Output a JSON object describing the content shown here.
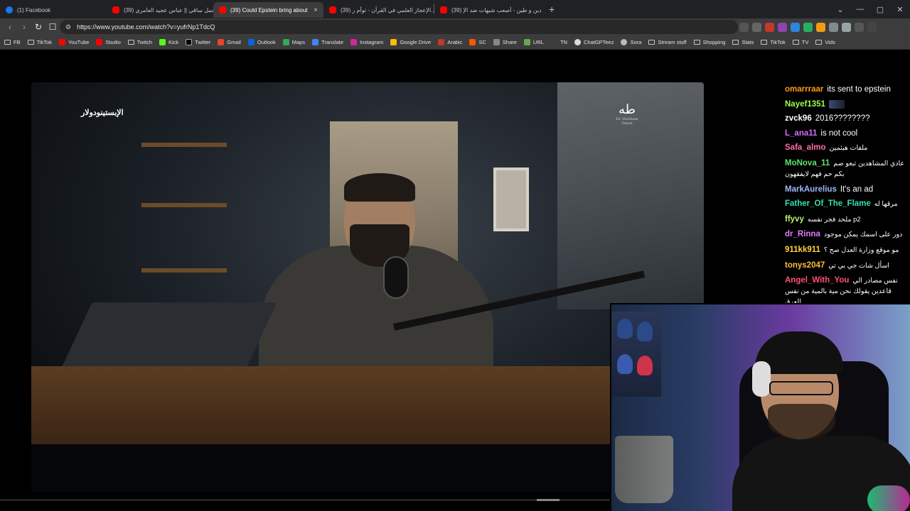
{
  "browser": {
    "tabs": [
      {
        "title": "(1) Facebook",
        "icon": "facebook-icon",
        "active": false
      },
      {
        "title": "(39) احمل ساقي || عباس عجيد العامري",
        "icon": "youtube-icon",
        "active": false
      },
      {
        "title": "(39) Could Epstein bring about t",
        "icon": "youtube-icon",
        "active": true
      },
      {
        "title": "(39) الإعجاز العلمي في القرآن - توأم ر...",
        "icon": "youtube-icon",
        "active": false
      },
      {
        "title": "(39) دين و طين - أصعب شبهات ضد الإ",
        "icon": "youtube-icon",
        "active": false
      }
    ],
    "close_glyph": "×",
    "new_tab_glyph": "+",
    "window_controls": {
      "dropdown": "⌄",
      "minimize": "—",
      "maximize": "▢",
      "close": "✕"
    },
    "url": "https://www.youtube.com/watch?v=yufrNp1TdcQ",
    "bookmarks": [
      {
        "label": "FB",
        "icon": "folder-icon"
      },
      {
        "label": "TikTok",
        "icon": "folder-icon"
      },
      {
        "label": "YouTube",
        "icon": "youtube-icon"
      },
      {
        "label": "Studio",
        "icon": "youtube-studio-icon"
      },
      {
        "label": "Twitch",
        "icon": "folder-icon"
      },
      {
        "label": "Kick",
        "icon": "kick-icon"
      },
      {
        "label": "Twitter",
        "icon": "x-icon"
      },
      {
        "label": "Gmail",
        "icon": "gmail-icon"
      },
      {
        "label": "Outlook",
        "icon": "outlook-icon"
      },
      {
        "label": "Maps",
        "icon": "maps-icon"
      },
      {
        "label": "Translate",
        "icon": "translate-icon"
      },
      {
        "label": "Instagram",
        "icon": "instagram-icon"
      },
      {
        "label": "Google Drive",
        "icon": "drive-icon"
      },
      {
        "label": "Arabic",
        "icon": "arabic-icon"
      },
      {
        "label": "SC",
        "icon": "soundcloud-icon"
      },
      {
        "label": "Share",
        "icon": "share-icon"
      },
      {
        "label": "URL",
        "icon": "url-icon"
      },
      {
        "label": "TN",
        "icon": "tn-icon"
      },
      {
        "label": "ChatGPTeez",
        "icon": "chatgpt-icon"
      },
      {
        "label": "Sora",
        "icon": "sora-icon"
      },
      {
        "label": "Stream stuff",
        "icon": "folder-icon"
      },
      {
        "label": "Shopping",
        "icon": "folder-icon"
      },
      {
        "label": "Stats",
        "icon": "folder-icon"
      },
      {
        "label": "TikTok",
        "icon": "folder-icon"
      },
      {
        "label": "TV",
        "icon": "folder-icon"
      },
      {
        "label": "Vids",
        "icon": "folder-icon"
      }
    ]
  },
  "video": {
    "caption": "الإبستينودولار",
    "logo_text": "طه",
    "logo_sub": "Dr. Haitham Talaat"
  },
  "chat": [
    {
      "user": "omarrraar",
      "color": "#ff9a1f",
      "text": "its sent to epstein"
    },
    {
      "user": "Nayef1351",
      "color": "#9cff4a",
      "text": "",
      "emote": true
    },
    {
      "user": "zvck96",
      "color": "#ffffff",
      "text": "2016????????"
    },
    {
      "user": "L_ana11",
      "color": "#d36bff",
      "text": "is not cool"
    },
    {
      "user": "Safa_almo",
      "color": "#ff6fa8",
      "text": "ملفات هيثمين",
      "ar": true
    },
    {
      "user": "MoNova_11",
      "color": "#5ce66a",
      "text": "عادي المشاهدين تبعو صم بكم حم فهم لايفقهون",
      "ar": true
    },
    {
      "user": "MarkAurelius",
      "color": "#9db8ff",
      "text": "It's an ad"
    },
    {
      "user": "Father_Of_The_Flame",
      "color": "#34e0b0",
      "text": "مرقها له",
      "ar": true
    },
    {
      "user": "ffyvy",
      "color": "#b7f26a",
      "text": "ملحد فجر نفسه p2",
      "ar": true
    },
    {
      "user": "dr_Rinna",
      "color": "#e07bff",
      "text": "دور على اسمك يمكن موجود",
      "ar": true
    },
    {
      "user": "911kk911",
      "color": "#ffd23f",
      "text": "مو موقع وزارة العدل صح ؟",
      "ar": true
    },
    {
      "user": "tonys2047",
      "color": "#ffbf3d",
      "text": "اسأل شات جي بي تي",
      "ar": true
    },
    {
      "user": "Angel_With_You",
      "color": "#ff4f7a",
      "text": "نفس مصادر الي قاعدين يقولك نحن مية بالمية من نفس العرق",
      "ar": true
    }
  ]
}
